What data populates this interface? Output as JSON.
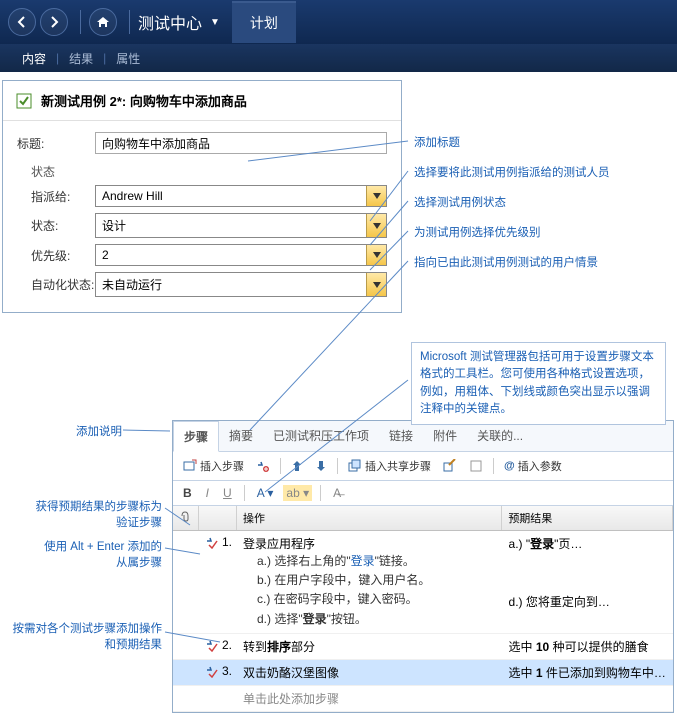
{
  "topbar": {
    "brand": "测试中心",
    "active_tab": "计划"
  },
  "subtabs": {
    "content": "内容",
    "results": "结果",
    "properties": "属性"
  },
  "form": {
    "header": "新测试用例  2*: 向购物车中添加商品",
    "title_label": "标题:",
    "title_value": "向购物车中添加商品",
    "state_label": "状态",
    "assigned_label": "指派给:",
    "assigned_value": "Andrew Hill",
    "status_label": "状态:",
    "status_value": "设计",
    "priority_label": "优先级:",
    "priority_value": "2",
    "auto_label": "自动化状态:",
    "auto_value": "未自动运行"
  },
  "callouts": {
    "add_title": "添加标题",
    "select_tester": "选择要将此测试用例指派给的测试人员",
    "select_state": "选择测试用例状态",
    "select_priority": "为测试用例选择优先级别",
    "point_user": "指向已由此测试用例测试的用户情景",
    "toolbar_note": "Microsoft 测试管理器包括可用于设置步骤文本格式的工具栏。您可使用各种格式设置选项，例如，用粗体、下划线或颜色突出显示以强调注释中的关键点。",
    "add_desc": "添加说明",
    "validate_step": "获得预期结果的步骤标为\n验证步骤",
    "alt_enter": "使用 Alt + Enter 添加的\n从属步骤",
    "add_action": "按需对各个测试步骤添加操作\n和预期结果"
  },
  "steps": {
    "tabs": {
      "steps": "步骤",
      "summary": "摘要",
      "tested": "已测试积压工作项",
      "links": "链接",
      "attach": "附件",
      "related": "关联的..."
    },
    "tb": {
      "insert_step": "插入步骤",
      "insert_shared": "插入共享步骤",
      "insert_param": "插入参数"
    },
    "header": {
      "action": "操作",
      "expected": "预期结果"
    },
    "rows": [
      {
        "num": "1.",
        "action_main": "登录应用程序",
        "subs": [
          {
            "prefix": "a.) 选择右上角的\"",
            "link": "登录",
            "suffix": "\"链接。"
          },
          {
            "text": "b.) 在用户字段中，键入用户名。"
          },
          {
            "text": "c.) 在密码字段中，键入密码。"
          },
          {
            "prefix": "d.) 选择\"",
            "bold": "登录",
            "suffix": "\"按钮。"
          }
        ],
        "expected": [
          {
            "prefix": "a.) \"",
            "bold": "登录",
            "suffix": "\"页…"
          },
          {
            "text": ""
          },
          {
            "text": ""
          },
          {
            "text": "d.) 您将重定向到…"
          }
        ]
      },
      {
        "num": "2.",
        "action_main_prefix": "转到",
        "action_main_bold": "排序",
        "action_main_suffix": "部分",
        "expected_prefix": "选中 ",
        "expected_bold": "10",
        "expected_suffix": " 种可以提供的膳食"
      },
      {
        "num": "3.",
        "action_main": "双击奶酪汉堡图像",
        "expected_prefix": "选中 ",
        "expected_bold": "1",
        "expected_suffix": " 件已添加到购物车中…",
        "selected": true
      },
      {
        "num": "",
        "action_main": "单击此处添加步骤",
        "ghost": true
      }
    ]
  }
}
